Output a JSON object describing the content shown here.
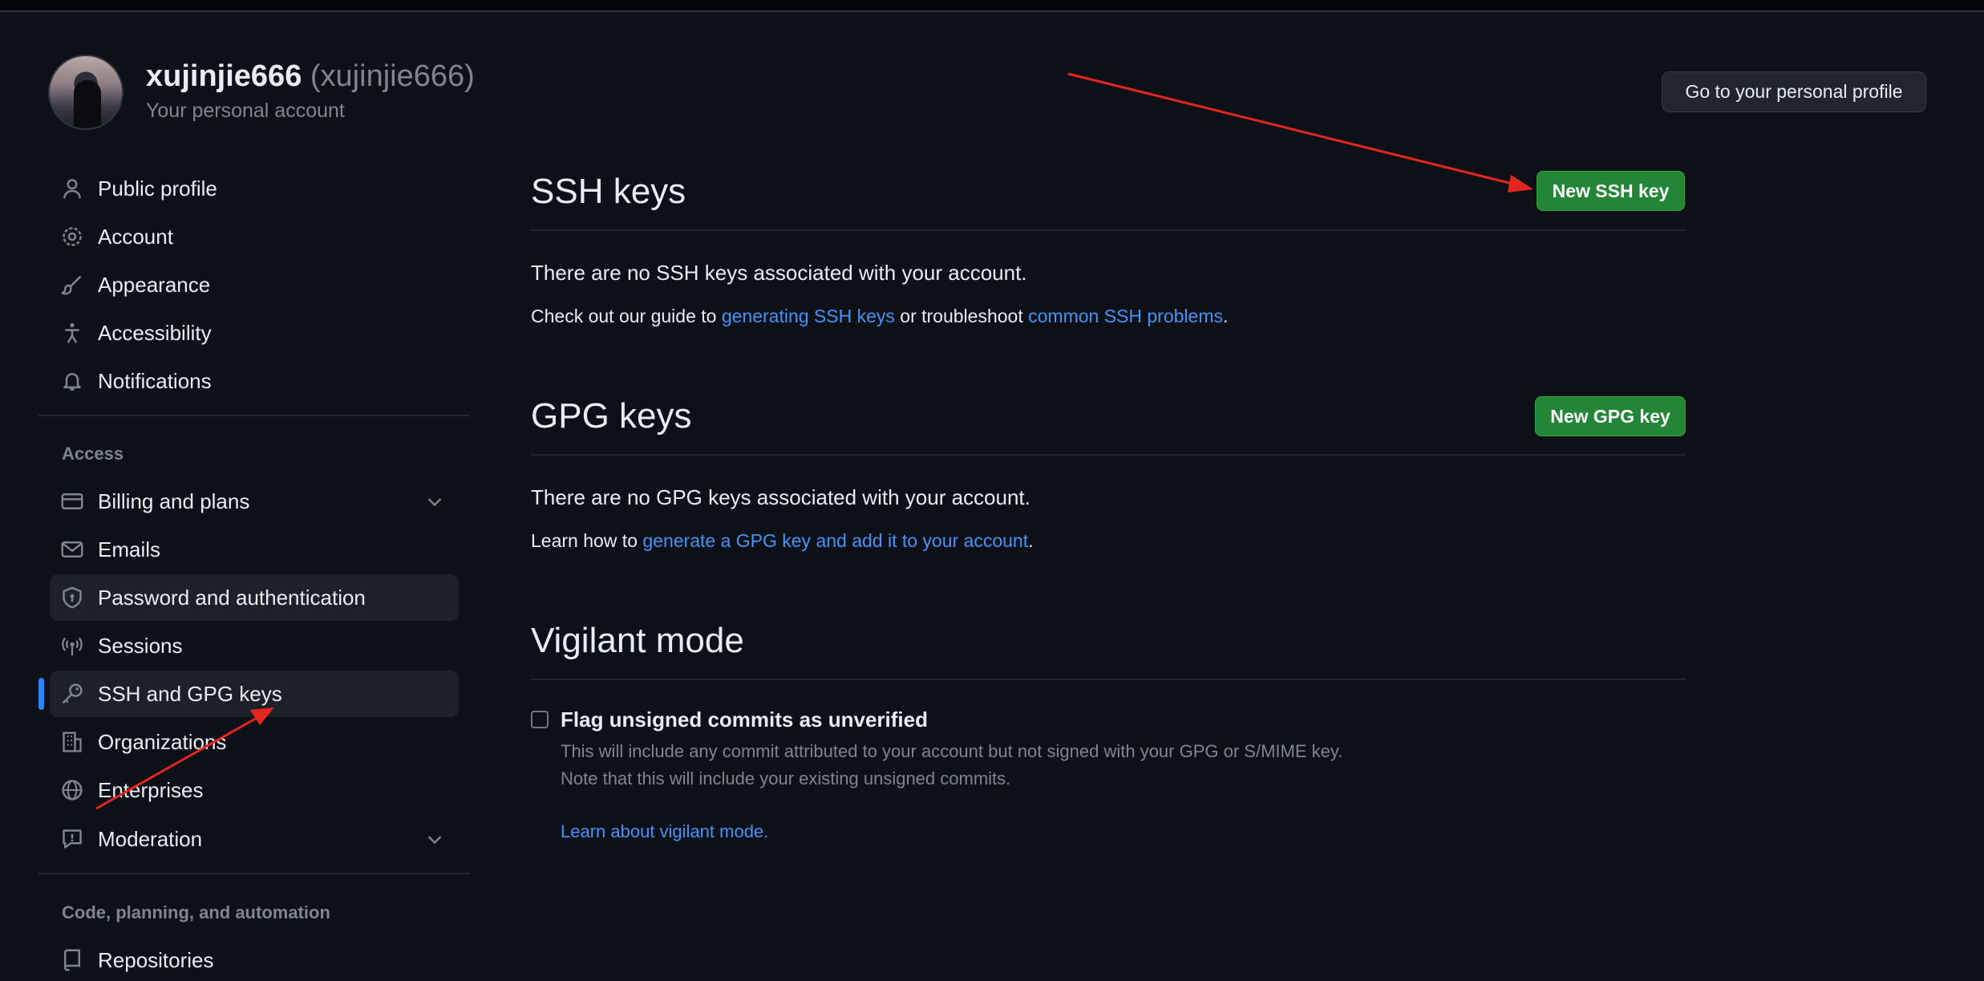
{
  "header": {
    "username": "xujinjie666",
    "login": "(xujinjie666)",
    "subtitle": "Your personal account",
    "profile_button": "Go to your personal profile"
  },
  "sidebar": {
    "items": [
      {
        "label": "Public profile",
        "icon": "person-icon"
      },
      {
        "label": "Account",
        "icon": "gear-icon"
      },
      {
        "label": "Appearance",
        "icon": "paintbrush-icon"
      },
      {
        "label": "Accessibility",
        "icon": "accessibility-icon"
      },
      {
        "label": "Notifications",
        "icon": "bell-icon"
      }
    ],
    "access_title": "Access",
    "access_items": [
      {
        "label": "Billing and plans",
        "icon": "credit-card-icon"
      },
      {
        "label": "Emails",
        "icon": "mail-icon"
      },
      {
        "label": "Password and authentication",
        "icon": "shield-lock-icon"
      },
      {
        "label": "Sessions",
        "icon": "broadcast-icon"
      },
      {
        "label": "SSH and GPG keys",
        "icon": "key-icon"
      },
      {
        "label": "Organizations",
        "icon": "organization-icon"
      },
      {
        "label": "Enterprises",
        "icon": "globe-icon"
      },
      {
        "label": "Moderation",
        "icon": "report-icon"
      }
    ],
    "code_title": "Code, planning, and automation",
    "code_items": [
      {
        "label": "Repositories",
        "icon": "repo-icon"
      }
    ]
  },
  "ssh": {
    "title": "SSH keys",
    "button": "New SSH key",
    "empty": "There are no SSH keys associated with your account.",
    "guide_prefix": "Check out our guide to ",
    "guide_link1": "generating SSH keys",
    "guide_mid": " or troubleshoot ",
    "guide_link2": "common SSH problems",
    "guide_suffix": "."
  },
  "gpg": {
    "title": "GPG keys",
    "button": "New GPG key",
    "empty": "There are no GPG keys associated with your account.",
    "learn_prefix": "Learn how to ",
    "learn_link": "generate a GPG key and add it to your account",
    "learn_suffix": "."
  },
  "vigilant": {
    "title": "Vigilant mode",
    "checkbox_label": "Flag unsigned commits as unverified",
    "note1": "This will include any commit attributed to your account but not signed with your GPG or S/MIME key.",
    "note2": "Note that this will include your existing unsigned commits.",
    "link": "Learn about vigilant mode."
  },
  "colors": {
    "background": "#0d1117",
    "accent_blue": "#2f81f7",
    "link": "#4493f8",
    "button_green": "#238636",
    "annotation_arrow": "#e5261f"
  }
}
